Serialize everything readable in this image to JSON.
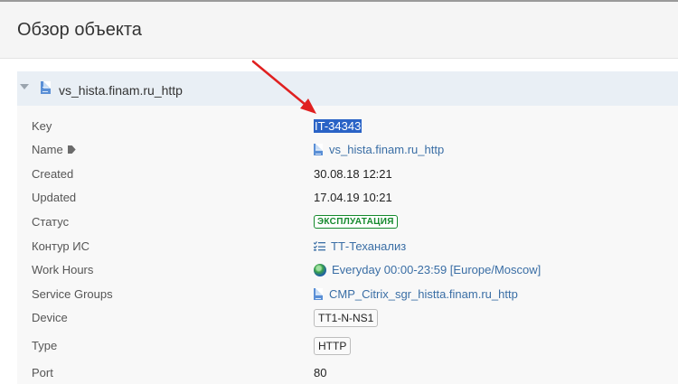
{
  "page": {
    "title": "Обзор объекта"
  },
  "object": {
    "name": "vs_hista.finam.ru_http"
  },
  "fields": {
    "key": {
      "label": "Key",
      "value": "IT-34343"
    },
    "name": {
      "label": "Name",
      "value": "vs_hista.finam.ru_http",
      "icon": "tag-icon"
    },
    "created": {
      "label": "Created",
      "value": "30.08.18 12:21"
    },
    "updated": {
      "label": "Updated",
      "value": "17.04.19 10:21"
    },
    "status": {
      "label": "Статус",
      "value": "ЭКСПЛУАТАЦИЯ",
      "color": "#14892c"
    },
    "contour": {
      "label": "Контур ИС",
      "value": "ТТ-Теханализ",
      "icon": "checklist-icon"
    },
    "work_hours": {
      "label": "Work Hours",
      "value": "Everyday 00:00-23:59 [Europe/Moscow]",
      "icon": "globe-icon"
    },
    "service_groups": {
      "label": "Service Groups",
      "value": "CMP_Citrix_sgr_histta.finam.ru_http",
      "icon": "file-icon"
    },
    "device": {
      "label": "Device",
      "value": "TT1-N-NS1"
    },
    "type": {
      "label": "Type",
      "value": "HTTP"
    },
    "port": {
      "label": "Port",
      "value": "80"
    }
  },
  "colors": {
    "link": "#3a6ea5",
    "selection": "#2a63c6",
    "arrow": "#e02020",
    "panel_header": "#e9eff5"
  }
}
